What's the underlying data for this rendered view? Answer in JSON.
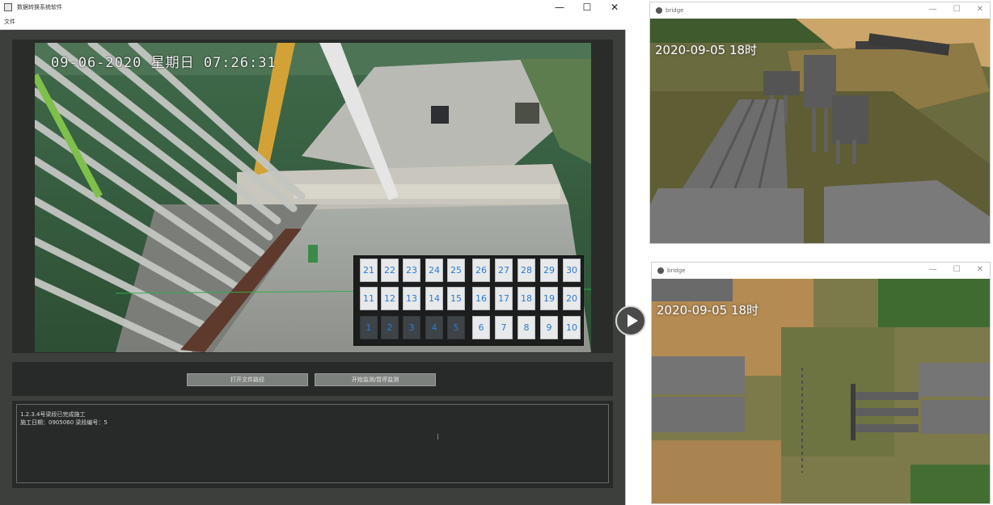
{
  "main_window": {
    "title": "数据转换系统软件",
    "controls": {
      "minimize": "—",
      "maximize": "☐",
      "close": "✕"
    },
    "menu": {
      "file": "文件"
    },
    "video": {
      "overlay_timestamp": "09-06-2020 星期日 07:26:31"
    },
    "segment_grid": {
      "rows": [
        [
          "21",
          "22",
          "23",
          "24",
          "25",
          "26",
          "27",
          "28",
          "29",
          "30"
        ],
        [
          "11",
          "12",
          "13",
          "14",
          "15",
          "16",
          "17",
          "18",
          "19",
          "20"
        ],
        [
          "1",
          "2",
          "3",
          "4",
          "5",
          "6",
          "7",
          "8",
          "9",
          "10"
        ]
      ],
      "completed_cells": [
        "1",
        "2",
        "3",
        "4",
        "5"
      ]
    },
    "buttons": {
      "open_file": "打开文件路径",
      "start_monitor": "开始监测/暂停监测"
    },
    "log": {
      "line1": "1.2.3.4号梁段已完成施工",
      "line2": "施工日期：0905060   梁段编号：5"
    }
  },
  "play_button": {
    "icon": "play-icon"
  },
  "bridge_windows": [
    {
      "title": "bridge",
      "timestamp": "2020-09-05 18时",
      "controls": {
        "minimize": "—",
        "maximize": "☐",
        "close": "✕"
      }
    },
    {
      "title": "bridge",
      "timestamp": "2020-09-05 18时",
      "controls": {
        "minimize": "—",
        "maximize": "☐",
        "close": "✕"
      }
    }
  ]
}
